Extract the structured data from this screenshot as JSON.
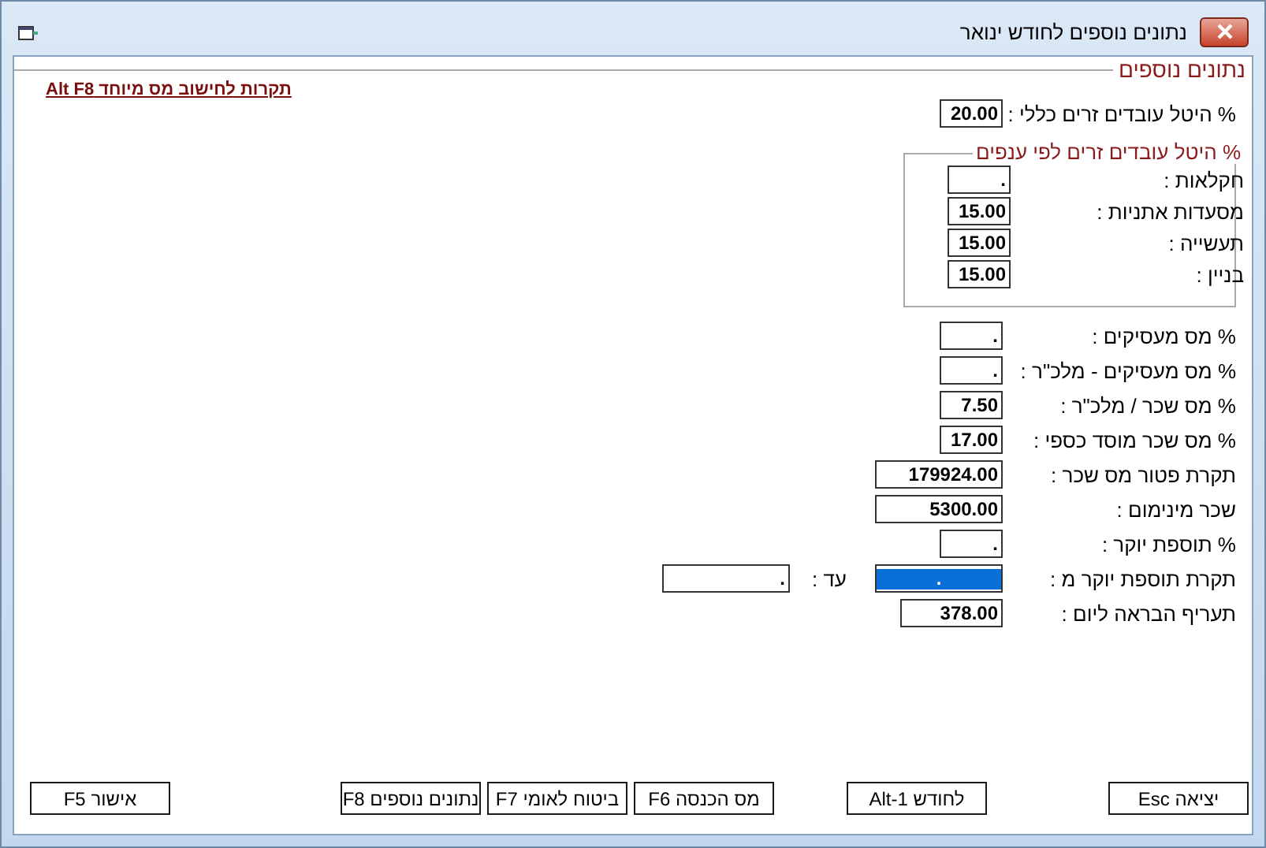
{
  "window": {
    "title": "נתונים נוספים לחודש ינואר"
  },
  "section_title": "נתונים נוספים",
  "special_tax_link": "תקרות לחישוב מס מיוחד Alt F8",
  "general_field": {
    "label": "% היטל עובדים זרים כללי :",
    "value": "20.00"
  },
  "sector_group": {
    "title": "% היטל עובדים זרים לפי ענפים",
    "fields": [
      {
        "label": "חקלאות :",
        "value": "."
      },
      {
        "label": "מסעדות אתניות :",
        "value": "15.00"
      },
      {
        "label": "תעשייה :",
        "value": "15.00"
      },
      {
        "label": "בניין :",
        "value": "15.00"
      }
    ]
  },
  "fields": [
    {
      "label": "% מס מעסיקים :",
      "value": ".",
      "kind": "short"
    },
    {
      "label": "% מס מעסיקים - מלכ\"ר :",
      "value": ".",
      "kind": "short"
    },
    {
      "label": "% מס שכר / מלכ\"ר :",
      "value": "7.50",
      "kind": "short"
    },
    {
      "label": "% מס שכר מוסד כספי :",
      "value": "17.00",
      "kind": "short"
    },
    {
      "label": "תקרת פטור מס שכר :",
      "value": "179924.00",
      "kind": "long"
    },
    {
      "label": "שכר מינימום :",
      "value": "5300.00",
      "kind": "long"
    },
    {
      "label": "% תוספת יוקר :",
      "value": ".",
      "kind": "short"
    },
    {
      "label": "תקרת תוספת יוקר מ :",
      "value": ".",
      "kind": "range",
      "focused": true,
      "to_label": "עד :",
      "to_value": "."
    },
    {
      "label": "תעריף הבראה ליום :",
      "value": "378.00",
      "kind": "medium"
    }
  ],
  "buttons": [
    "יציאה Esc",
    "לחודש Alt-1",
    "מס הכנסה F6",
    "ביטוח לאומי F7",
    "נתונים נוספים F8",
    "אישור F5"
  ]
}
